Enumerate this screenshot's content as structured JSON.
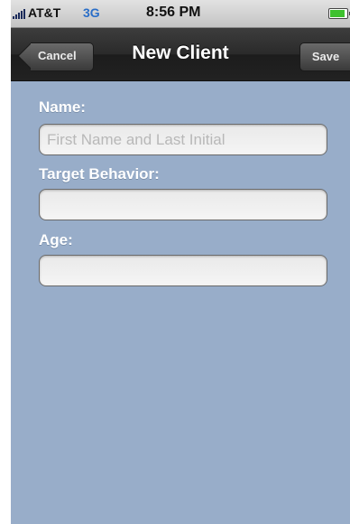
{
  "status_bar": {
    "carrier": "AT&T",
    "network": "3G",
    "time": "8:56 PM",
    "battery_level": 0.9,
    "battery_color": "#3ec12f",
    "network_color": "#2a6ec8"
  },
  "nav": {
    "title": "New Client",
    "cancel_label": "Cancel",
    "save_label": "Save"
  },
  "form": {
    "name_label": "Name:",
    "name_placeholder": "First Name and Last Initial",
    "name_value": "",
    "target_label": "Target Behavior:",
    "target_value": "",
    "age_label": "Age:",
    "age_value": ""
  },
  "colors": {
    "background": "#98adc9",
    "nav_bar": "#2a2a2a"
  }
}
